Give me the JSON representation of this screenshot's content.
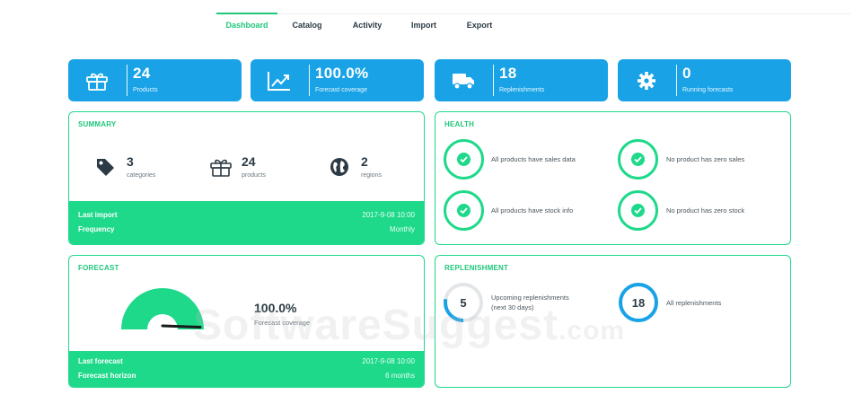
{
  "nav": {
    "items": [
      {
        "label": "Dashboard",
        "active": true
      },
      {
        "label": "Catalog",
        "active": false
      },
      {
        "label": "Activity",
        "active": false
      },
      {
        "label": "Import",
        "active": false
      },
      {
        "label": "Export",
        "active": false
      }
    ]
  },
  "tiles": [
    {
      "icon": "gift-icon",
      "value": "24",
      "label": "Products"
    },
    {
      "icon": "trend-chart-icon",
      "value": "100.0%",
      "label": "Forecast coverage"
    },
    {
      "icon": "truck-icon",
      "value": "18",
      "label": "Replenishments"
    },
    {
      "icon": "gear-icon",
      "value": "0",
      "label": "Running forecasts"
    }
  ],
  "summary": {
    "title": "SUMMARY",
    "items": [
      {
        "icon": "tag-icon",
        "value": "3",
        "label": "categories"
      },
      {
        "icon": "gift-icon",
        "value": "24",
        "label": "products"
      },
      {
        "icon": "globe-icon",
        "value": "2",
        "label": "regions"
      }
    ],
    "footer": {
      "last_import_label": "Last import",
      "last_import_value": "2017-9-08 10:00",
      "frequency_label": "Frequency",
      "frequency_value": "Monthly"
    }
  },
  "health": {
    "title": "HEALTH",
    "checks": [
      "All products have sales data",
      "No product has zero sales",
      "All products have stock info",
      "No product has zero stock"
    ]
  },
  "forecast": {
    "title": "FORECAST",
    "value": "100.0%",
    "label": "Forecast coverage",
    "gauge_fraction": 1.0,
    "footer": {
      "last_forecast_label": "Last forecast",
      "last_forecast_value": "2017-9-08 10:00",
      "horizon_label": "Forecast horizon",
      "horizon_value": "6 months"
    }
  },
  "replenishment": {
    "title": "REPLENISHMENT",
    "items": [
      {
        "value": "5",
        "label_line1": "Upcoming replenishments",
        "label_line2": "(next 30 days)",
        "ring_fraction": 0.28
      },
      {
        "value": "18",
        "label_line1": "All replenishments",
        "label_line2": "",
        "ring_fraction": 1.0
      }
    ]
  },
  "watermark": {
    "main": "SoftwareSuggest",
    "suffix": ".com"
  },
  "colors": {
    "green": "#1fd98a",
    "blue": "#19a3e6",
    "ring_gray": "#e3e6e8",
    "dark": "#2b3a44"
  }
}
